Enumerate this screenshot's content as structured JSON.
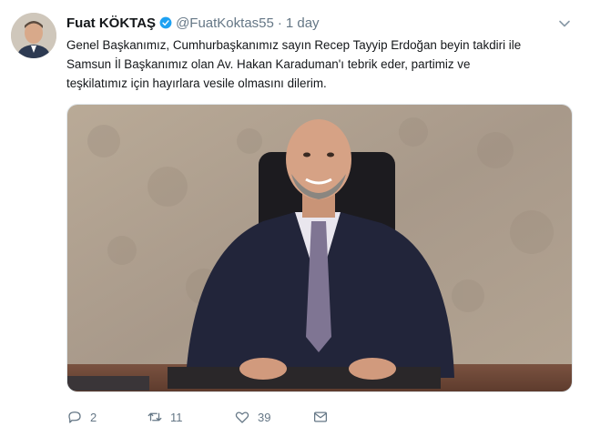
{
  "tweet": {
    "author_name": "Fuat KÖKTAŞ",
    "handle": "@FuatKoktas55",
    "separator": "·",
    "time": "1 day",
    "text_lines": [
      "Genel Başkanımız, Cumhurbaşkanımız sayın Recep Tayyip Erdoğan beyin takdiri ile",
      "Samsun İl Başkanımız olan Av. Hakan Karaduman'ı tebrik eder, partimiz ve",
      "teşkilatımız için hayırlara vesile olmasını dilerim."
    ],
    "actions": {
      "reply_count": "2",
      "retweet_count": "11",
      "like_count": "39"
    }
  },
  "icons": {
    "verified": "verified-badge-icon",
    "caret": "chevron-down-icon",
    "reply": "reply-icon",
    "retweet": "retweet-icon",
    "like": "heart-icon",
    "dm": "envelope-icon"
  },
  "colors": {
    "verified_blue": "#1da1f2",
    "meta_gray": "#657786",
    "text": "#14171a"
  }
}
